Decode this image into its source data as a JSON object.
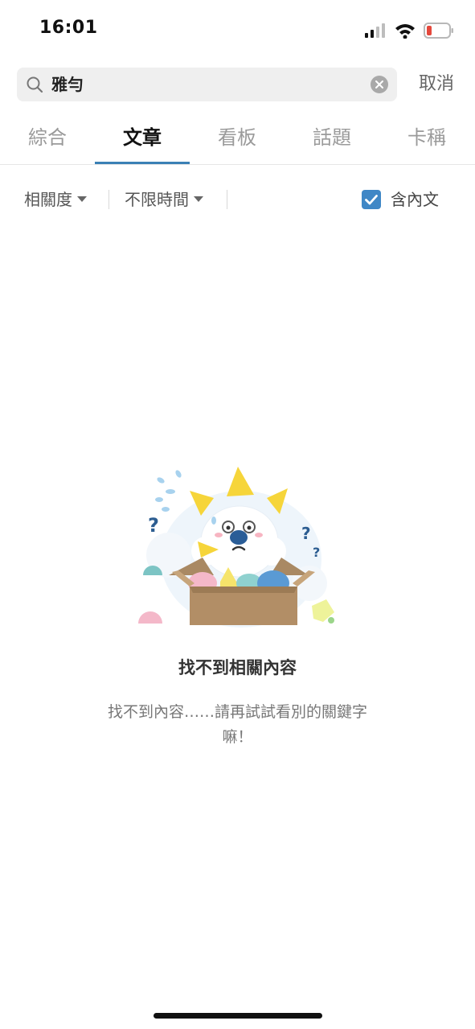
{
  "status_bar": {
    "time": "16:01"
  },
  "search": {
    "query": "雅勻",
    "cancel_label": "取消"
  },
  "tabs": [
    {
      "label": "綜合",
      "active": false
    },
    {
      "label": "文章",
      "active": true
    },
    {
      "label": "看板",
      "active": false
    },
    {
      "label": "話題",
      "active": false
    },
    {
      "label": "卡稱",
      "active": false
    }
  ],
  "filters": {
    "sort_label": "相關度",
    "time_label": "不限時間",
    "include_content_label": "含內文",
    "include_content_checked": true
  },
  "empty_state": {
    "title": "找不到相關內容",
    "message": "找不到內容……請再試試看別的關鍵字嘛！"
  },
  "colors": {
    "accent": "#3b80b5",
    "checkbox": "#3f87c6"
  }
}
